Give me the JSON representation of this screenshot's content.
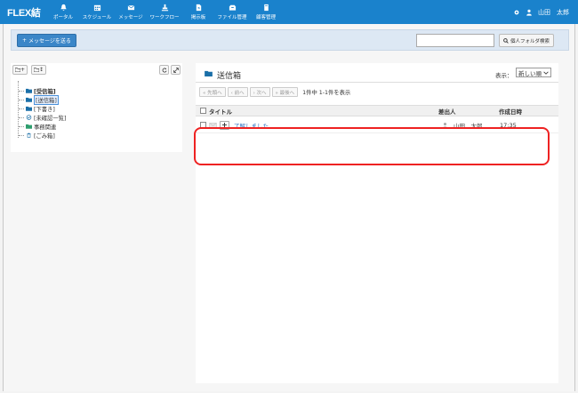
{
  "app": {
    "logo": "FLEX結"
  },
  "nav": [
    {
      "icon": "bell-icon",
      "label": "ポータル"
    },
    {
      "icon": "calendar-icon",
      "label": "スケジュール"
    },
    {
      "icon": "envelope-icon",
      "label": "メッセージ"
    },
    {
      "icon": "workflow-icon",
      "label": "ワークフロー"
    },
    {
      "icon": "bulletin-icon",
      "label": "掲示板"
    },
    {
      "icon": "file-box-icon",
      "label": "ファイル管理"
    },
    {
      "icon": "document-icon",
      "label": "顧客管理"
    }
  ],
  "user": {
    "name": "山田　太郎"
  },
  "actions": {
    "send_message": "メッセージを送る",
    "search_placeholder": "",
    "search_button": "個人フォルダ検索"
  },
  "tree_toolbar": {
    "add_folder": "+",
    "sort": "↕"
  },
  "folders": [
    {
      "label": "[受信箱]",
      "icon": "folder-icon",
      "bold": true
    },
    {
      "label": "[送信箱]",
      "icon": "folder-icon",
      "selected": true
    },
    {
      "label": "[下書き]",
      "icon": "folder-icon"
    },
    {
      "label": "[未確認一覧]",
      "icon": "check-circle-icon"
    },
    {
      "label": "事務関連",
      "icon": "folder-icon"
    },
    {
      "label": "[ごみ箱]",
      "icon": "trash-icon"
    }
  ],
  "main": {
    "title": "送信箱",
    "display_label": "表示：",
    "display_value": "新しい順",
    "pager": {
      "first": "« 先頭へ",
      "prev": "‹ 前へ",
      "next": "› 次へ",
      "last": "» 最後へ",
      "info": "1件中 1-1件を表示"
    },
    "columns": {
      "title": "タイトル",
      "sender": "差出人",
      "date": "作成日時"
    },
    "rows": [
      {
        "title": "了解しました",
        "sender": "山田　太郎",
        "date": "17:35"
      }
    ]
  },
  "colors": {
    "topbar": "#1a82cc",
    "accent": "#3a86c8",
    "highlight": "#e22222"
  }
}
